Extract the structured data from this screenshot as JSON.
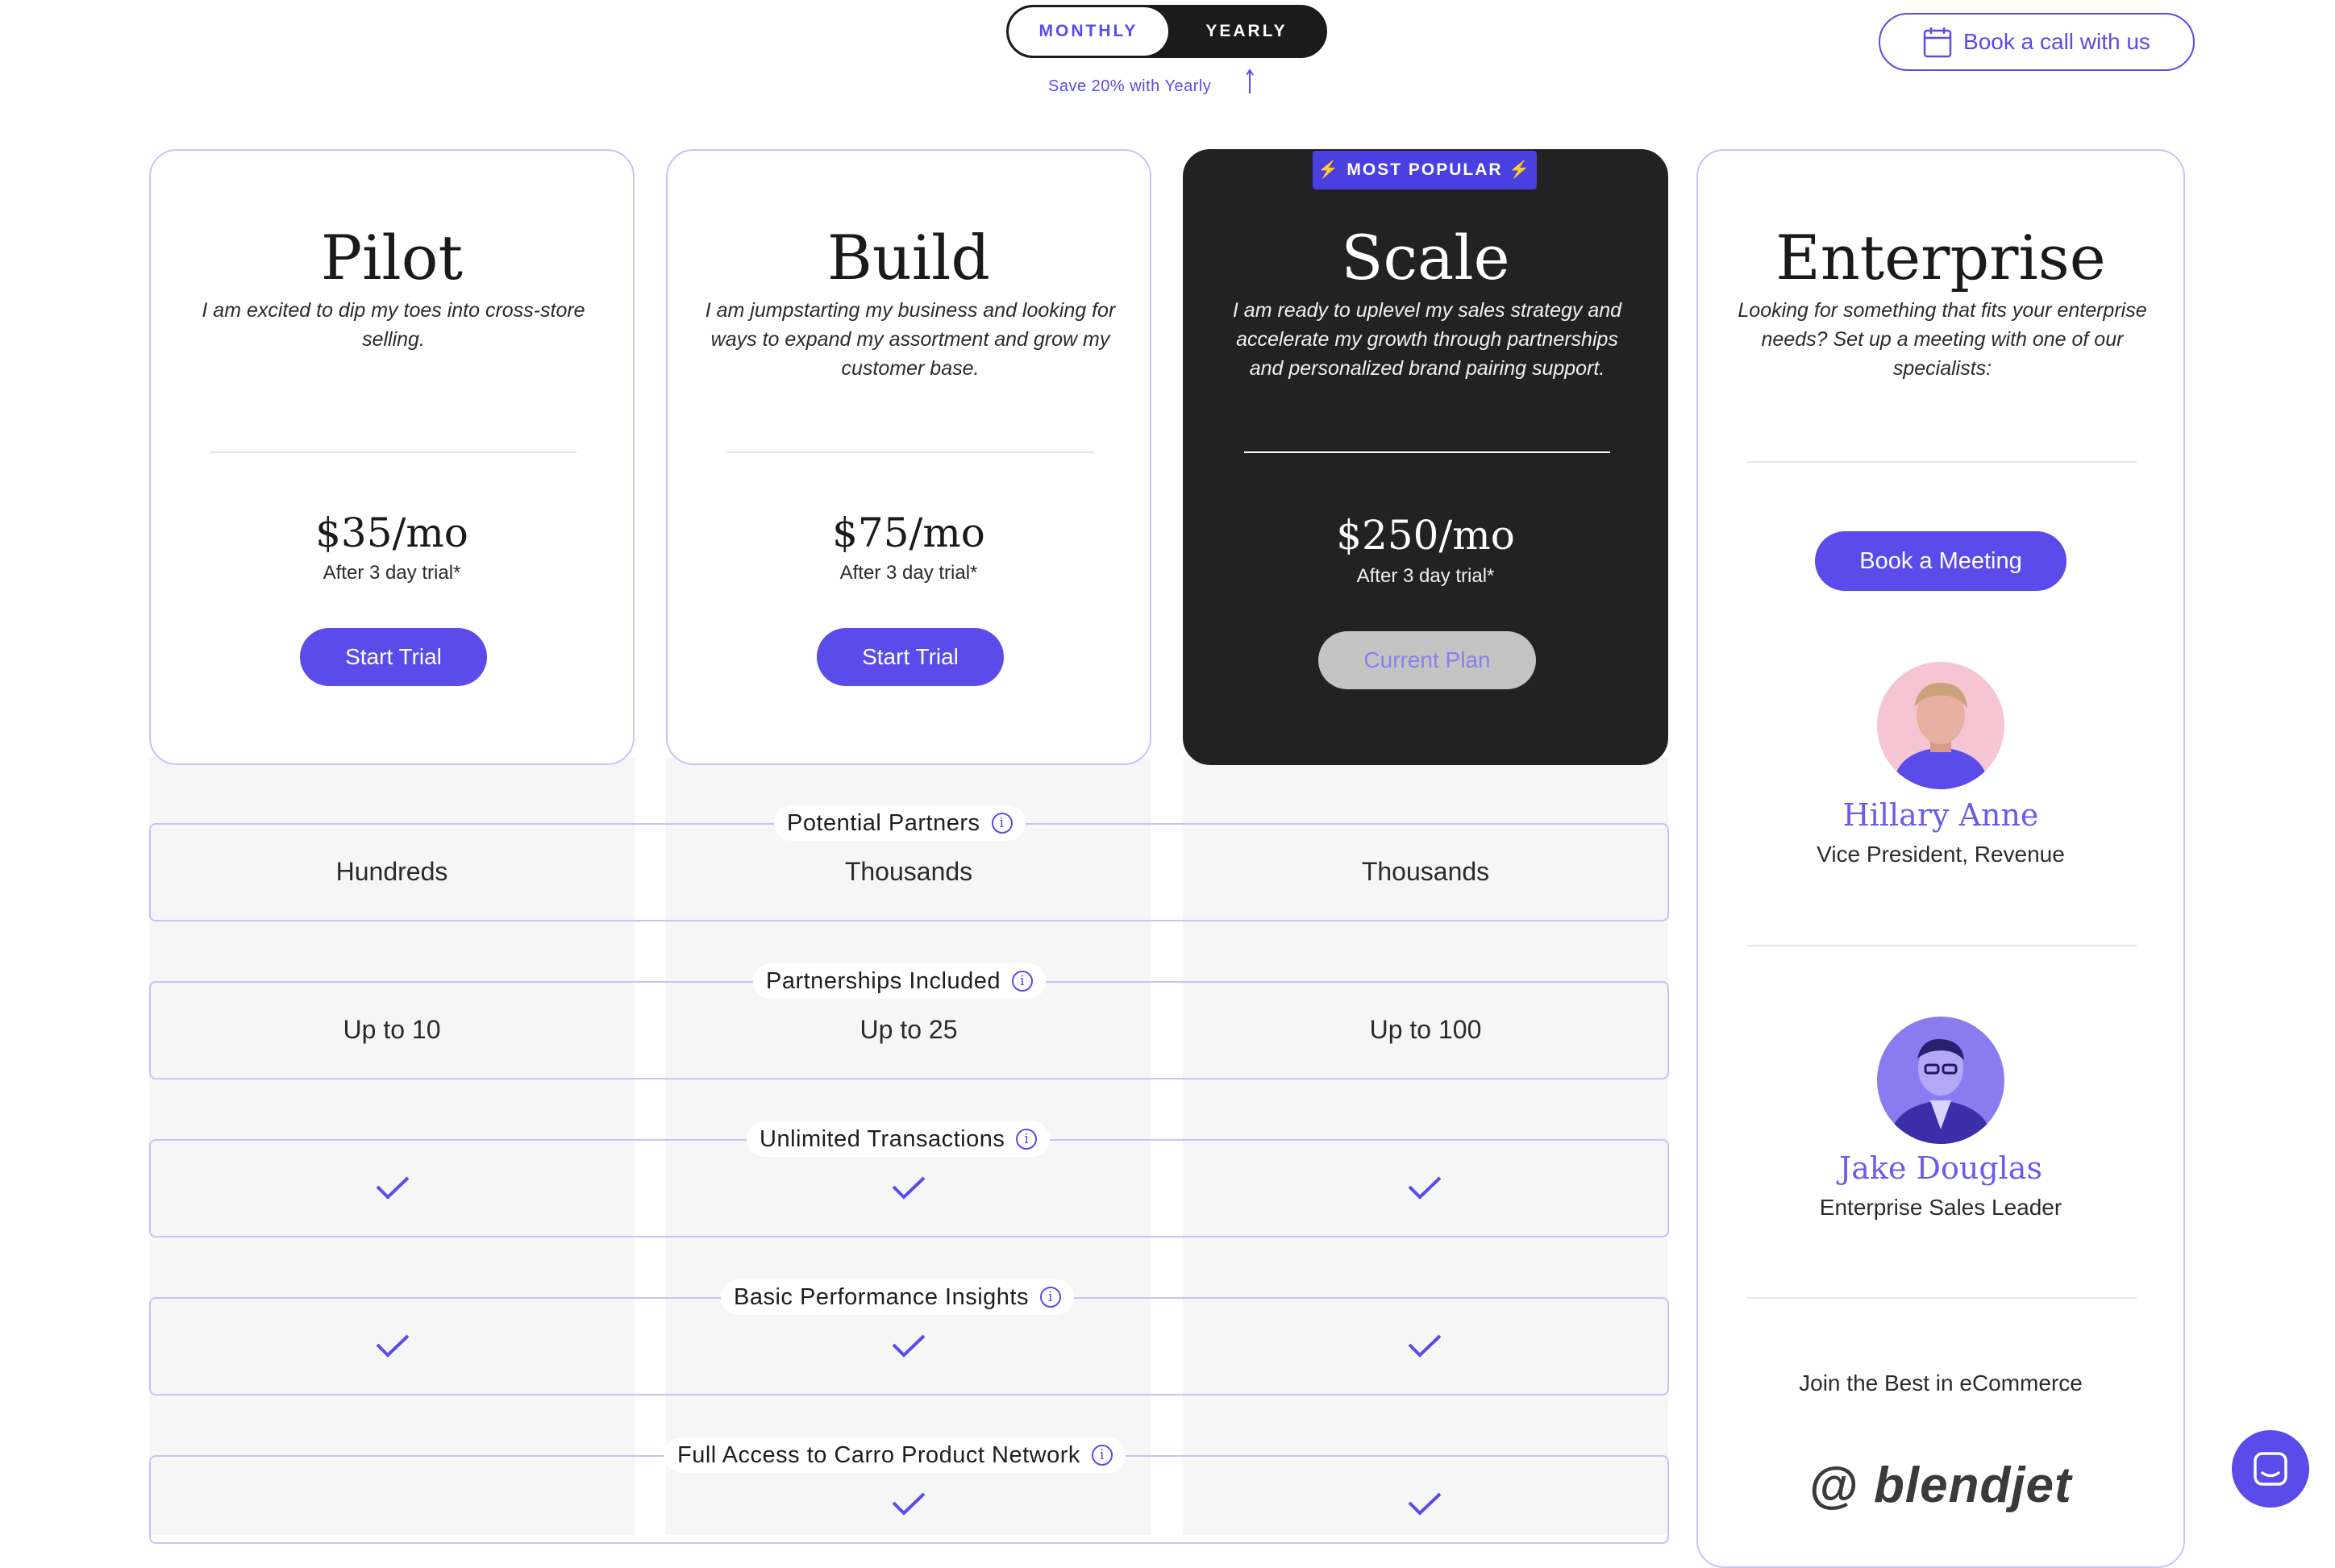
{
  "billing_toggle": {
    "monthly": "MONTHLY",
    "yearly": "YEARLY",
    "save_note": "Save 20% with Yearly"
  },
  "book_call": {
    "label": "Book a call with us",
    "icon": "calendar-icon"
  },
  "plans": [
    {
      "name": "Pilot",
      "desc": "I am excited to dip my toes into cross-store selling.",
      "price": "$35/mo",
      "trial": "After 3 day trial*",
      "button": "Start Trial"
    },
    {
      "name": "Build",
      "desc": "I am jumpstarting my business and looking for ways to expand my assortment and grow my customer base.",
      "price": "$75/mo",
      "trial": "After 3 day trial*",
      "button": "Start Trial"
    },
    {
      "name": "Scale",
      "badge": "⚡ MOST POPULAR ⚡",
      "desc": "I am ready to uplevel my sales strategy and accelerate my growth through partnerships and personalized brand pairing support.",
      "price": "$250/mo",
      "trial": "After 3 day trial*",
      "button": "Current Plan"
    }
  ],
  "enterprise": {
    "name": "Enterprise",
    "desc": "Looking for something that fits your enterprise needs? Set up a meeting with one of our specialists:",
    "button": "Book a Meeting",
    "people": [
      {
        "name": "Hillary Anne",
        "role": "Vice President, Revenue"
      },
      {
        "name": "Jake Douglas",
        "role": "Enterprise Sales Leader"
      }
    ],
    "join_text": "Join the Best in eCommerce",
    "logo_text": "blendjet"
  },
  "features": [
    {
      "label": "Potential Partners",
      "values": [
        "Hundreds",
        "Thousands",
        "Thousands"
      ]
    },
    {
      "label": "Partnerships Included",
      "values": [
        "Up to 10",
        "Up to 25",
        "Up to 100"
      ]
    },
    {
      "label": "Unlimited Transactions",
      "values": [
        "check",
        "check",
        "check"
      ]
    },
    {
      "label": "Basic Performance Insights",
      "values": [
        "check",
        "check",
        "check"
      ]
    },
    {
      "label": "Full Access to Carro Product Network",
      "values": [
        "",
        "check",
        "check"
      ]
    }
  ],
  "colors": {
    "accent": "#5a4bea",
    "dark_card": "#222222",
    "border": "#c9c2f7"
  }
}
